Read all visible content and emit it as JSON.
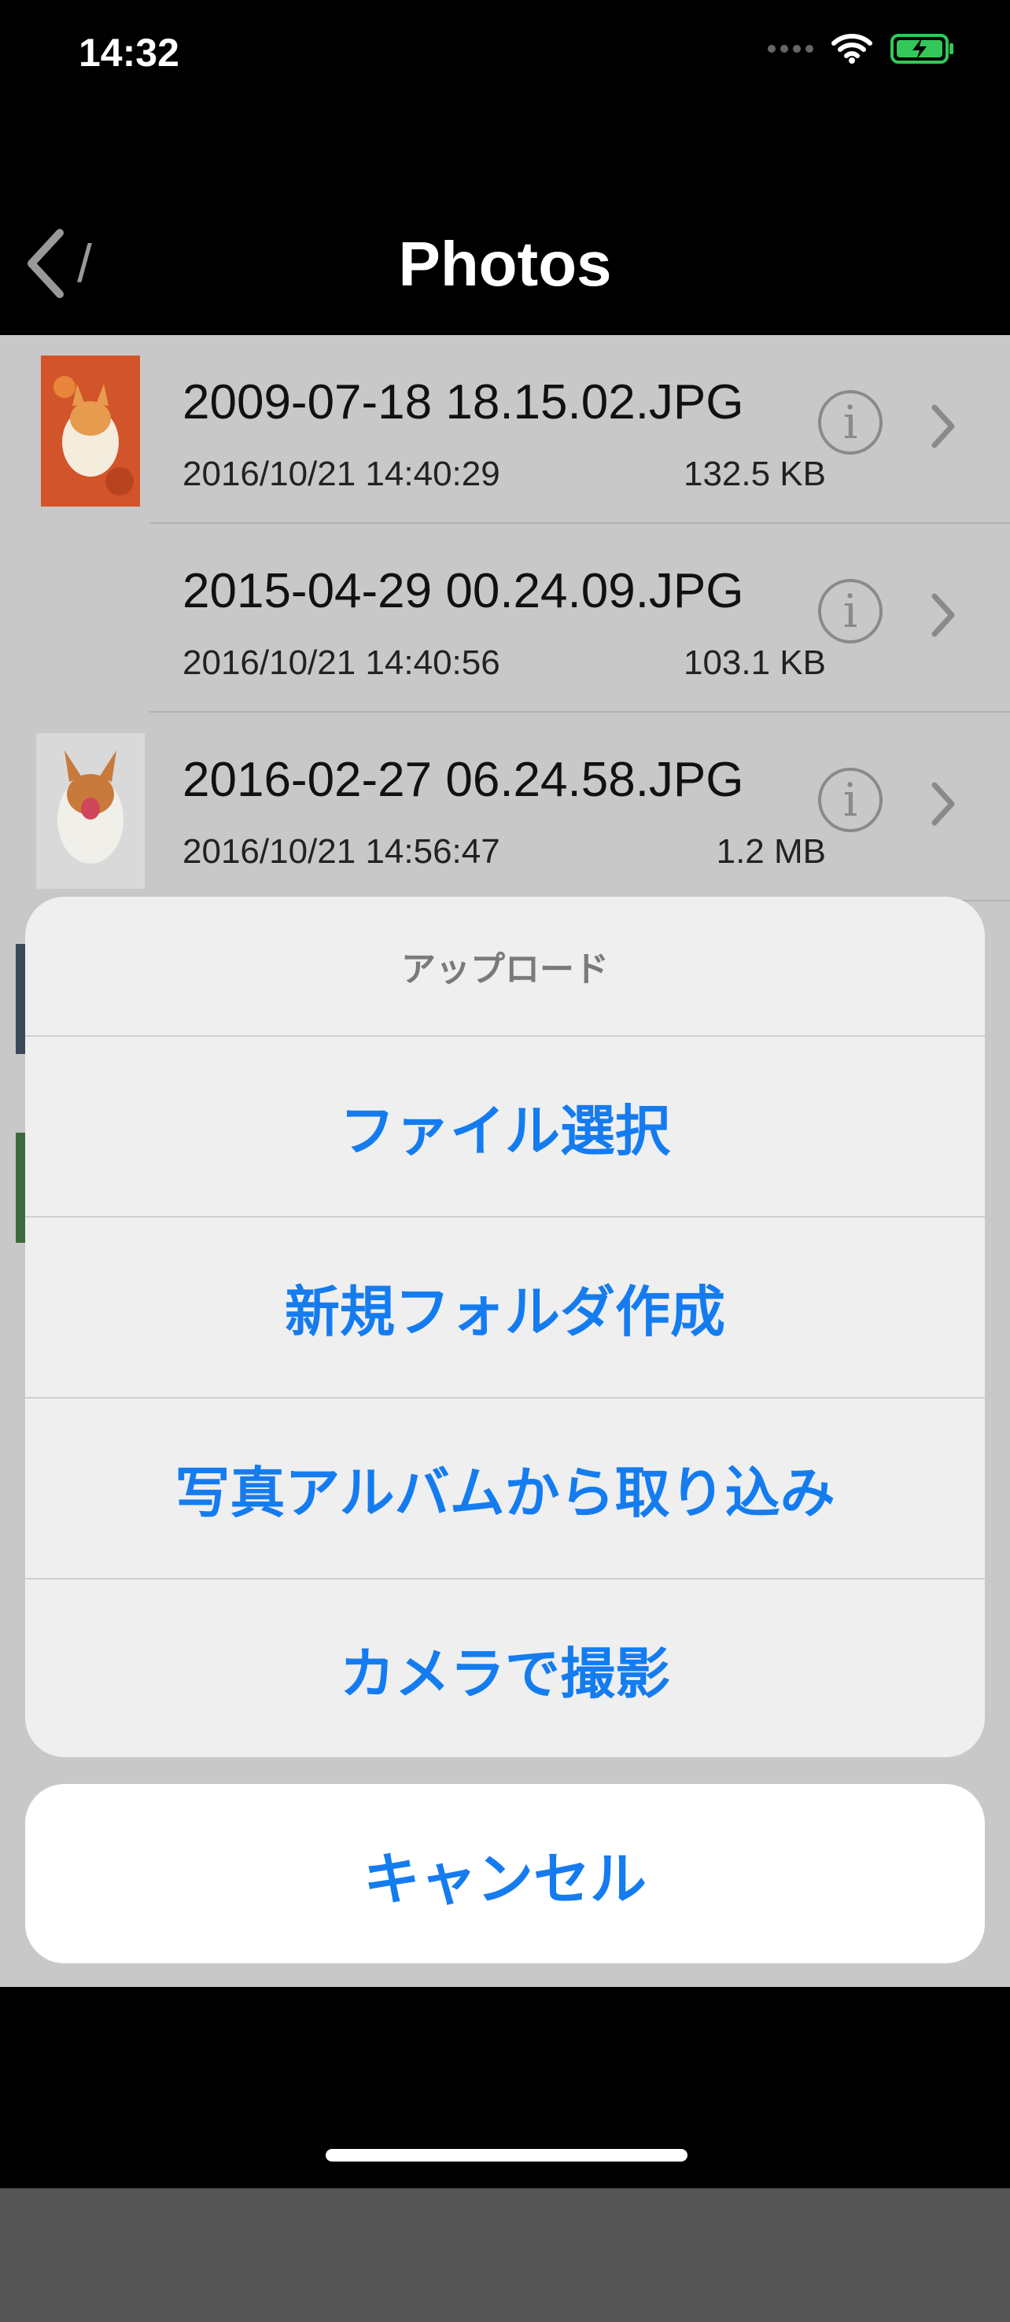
{
  "status_bar": {
    "time": "14:32",
    "wifi_icon": "wifi-icon",
    "battery_icon": "battery-charging-icon",
    "battery_color": "#34c759"
  },
  "nav": {
    "title": "Photos",
    "back_icon": "chevron-left-icon",
    "path_separator": "/"
  },
  "files": [
    {
      "name": "2009-07-18 18.15.02.JPG",
      "date": "2016/10/21 14:40:29",
      "size": "132.5 KB"
    },
    {
      "name": "2015-04-29 00.24.09.JPG",
      "date": "2016/10/21 14:40:56",
      "size": "103.1 KB"
    },
    {
      "name": "2016-02-27 06.24.58.JPG",
      "date": "2016/10/21 14:56:47",
      "size": "1.2 MB"
    }
  ],
  "action_sheet": {
    "title": "アップロード",
    "actions": [
      "ファイル選択",
      "新規フォルダ作成",
      "写真アルバムから取り込み",
      "カメラで撮影"
    ],
    "cancel": "キャンセル"
  },
  "colors": {
    "accent": "#157cf0",
    "list_background": "#c8c8c8",
    "sheet_background": "#efefef"
  }
}
